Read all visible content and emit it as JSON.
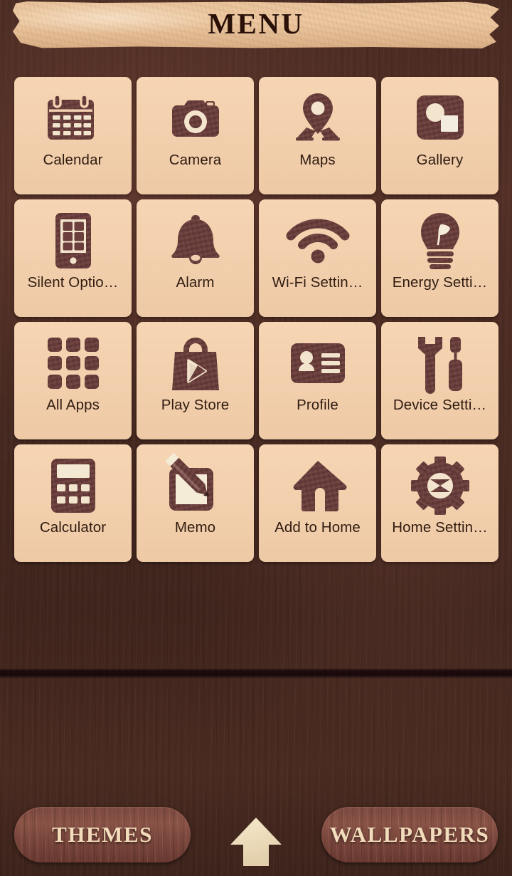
{
  "header": {
    "title": "MENU",
    "banner_color": "#e9c49c",
    "title_color": "#2a1108"
  },
  "theme": {
    "background_color": "#4a2b22",
    "tile_color": "#f2cfac",
    "icon_color": "#6b3f3d",
    "label_color": "#2f1c10",
    "dock_pill_color": "#7d4a40",
    "dock_label_color": "#f3dcbb"
  },
  "grid": {
    "columns": 4,
    "rows": 4,
    "items": [
      {
        "label": "Calendar",
        "icon": "calendar-icon"
      },
      {
        "label": "Camera",
        "icon": "camera-icon"
      },
      {
        "label": "Maps",
        "icon": "map-pin-icon"
      },
      {
        "label": "Gallery",
        "icon": "gallery-icon"
      },
      {
        "label": "Silent Optio…",
        "icon": "phone-grid-icon"
      },
      {
        "label": "Alarm",
        "icon": "bell-icon"
      },
      {
        "label": "Wi-Fi Settin…",
        "icon": "wifi-icon"
      },
      {
        "label": "Energy Setti…",
        "icon": "lightbulb-leaf-icon"
      },
      {
        "label": "All Apps",
        "icon": "app-grid-icon"
      },
      {
        "label": "Play Store",
        "icon": "shopping-bag-play-icon"
      },
      {
        "label": "Profile",
        "icon": "id-card-icon"
      },
      {
        "label": "Device Setti…",
        "icon": "wrench-screwdriver-icon"
      },
      {
        "label": "Calculator",
        "icon": "calculator-icon"
      },
      {
        "label": "Memo",
        "icon": "note-pencil-icon"
      },
      {
        "label": "Add to Home",
        "icon": "house-icon"
      },
      {
        "label": "Home Settin…",
        "icon": "gear-icon"
      }
    ]
  },
  "dock": {
    "themes_label": "THEMES",
    "wallpapers_label": "WALLPAPERS",
    "home_icon": "arrow-up-icon"
  }
}
